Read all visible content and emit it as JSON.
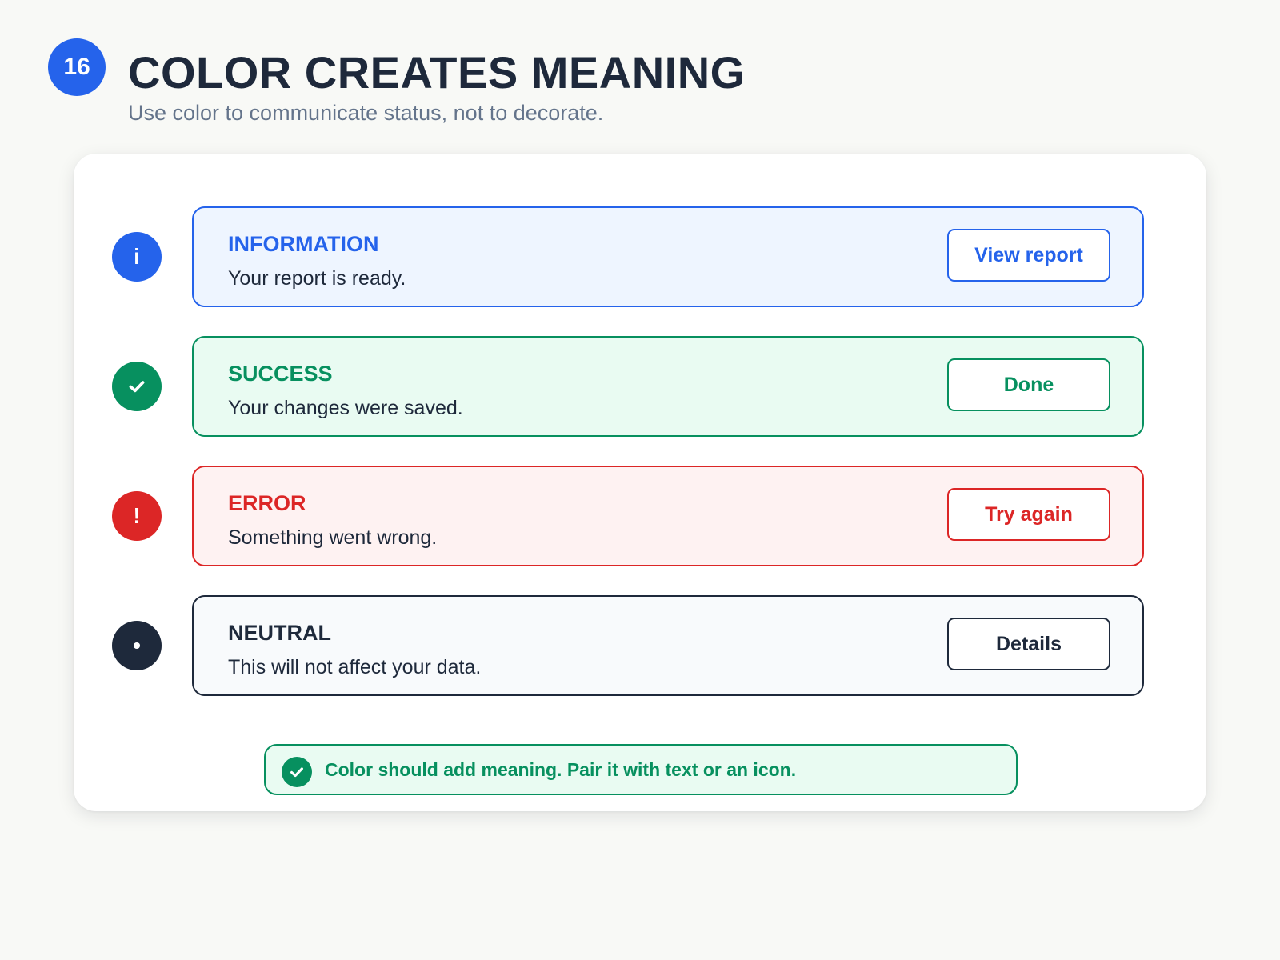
{
  "header": {
    "step_number": "16",
    "title": "COLOR CREATES MEANING",
    "subtitle": "Use color to communicate status, not to decorate."
  },
  "alerts": [
    {
      "icon": "info-icon",
      "icon_glyph": "i",
      "title": "INFORMATION",
      "message": "Your report is ready.",
      "button_label": "View report",
      "color": "#2563eb"
    },
    {
      "icon": "check-icon",
      "icon_glyph": "",
      "title": "SUCCESS",
      "message": "Your changes were saved.",
      "button_label": "Done",
      "color": "#07905f"
    },
    {
      "icon": "exclamation-icon",
      "icon_glyph": "!",
      "title": "ERROR",
      "message": "Something went wrong.",
      "button_label": "Try again",
      "color": "#dc2626"
    },
    {
      "icon": "dot-icon",
      "icon_glyph": "•",
      "title": "NEUTRAL",
      "message": "This will not affect your data.",
      "button_label": "Details",
      "color": "#1e293b"
    }
  ],
  "tip": {
    "icon": "check-circle-icon",
    "text": "Color should add meaning. Pair it with text or an icon.",
    "color": "#07905f"
  },
  "colors": {
    "background": "#f8f9f6",
    "card": "#ffffff",
    "title": "#1e293b",
    "subtitle": "#64748b",
    "accent": "#2563eb"
  }
}
